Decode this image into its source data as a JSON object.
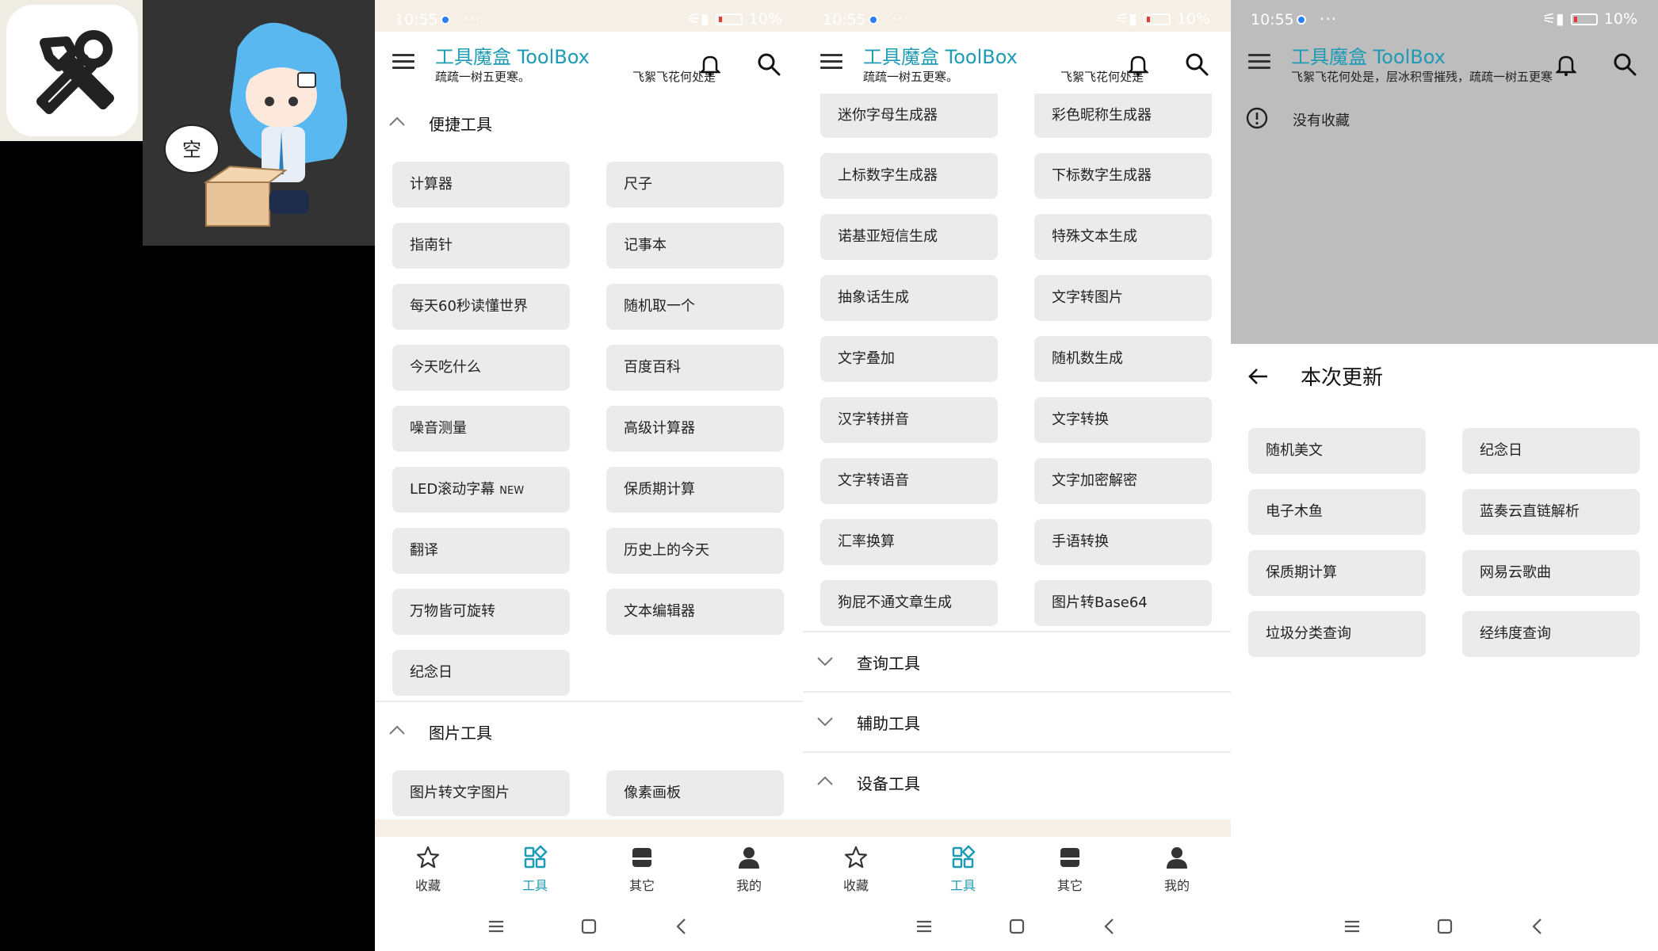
{
  "promo": {
    "logo_icon": "tools-wrench-hammer-icon",
    "mascot_badge": "空"
  },
  "status": {
    "time": "10:55",
    "more": "···",
    "battery": "10%"
  },
  "app": {
    "title": "工具魔盒 ToolBox",
    "subtitle": "疏疏一树五更寒。",
    "marquee": "飞絮飞花何处是",
    "subtitle_full": "飞絮飞花何处是，层冰积雪摧残，疏疏一树五更寒"
  },
  "panel1": {
    "sections": [
      {
        "label": "便捷工具",
        "items": [
          "计算器",
          "尺子",
          "指南针",
          "记事本",
          "每天60秒读懂世界",
          "随机取一个",
          "今天吃什么",
          "百度百科",
          "噪音测量",
          "高级计算器",
          "LED滚动字幕",
          "保质期计算",
          "翻译",
          "历史上的今天",
          "万物皆可旋转",
          "文本编辑器",
          "纪念日"
        ],
        "new_badge": "NEW"
      },
      {
        "label": "图片工具",
        "items": [
          "图片转文字图片",
          "像素画板"
        ]
      }
    ]
  },
  "panel2": {
    "items": [
      "迷你字母生成器",
      "彩色昵称生成器",
      "上标数字生成器",
      "下标数字生成器",
      "诺基亚短信生成",
      "特殊文本生成",
      "抽象话生成",
      "文字转图片",
      "文字叠加",
      "随机数生成",
      "汉字转拼音",
      "文字转换",
      "文字转语音",
      "文字加密解密",
      "汇率换算",
      "手语转换",
      "狗屁不通文章生成",
      "图片转Base64"
    ],
    "sections": [
      "查询工具",
      "辅助工具",
      "设备工具"
    ]
  },
  "panel3": {
    "empty_text": "没有收藏",
    "sheet_title": "本次更新",
    "items": [
      "随机美文",
      "纪念日",
      "电子木鱼",
      "蓝奏云直链解析",
      "保质期计算",
      "网易云歌曲",
      "垃圾分类查询",
      "经纬度查询"
    ]
  },
  "nav": {
    "items": [
      {
        "label": "收藏",
        "icon": "star-icon"
      },
      {
        "label": "工具",
        "icon": "grid-apps-icon"
      },
      {
        "label": "其它",
        "icon": "box-icon"
      },
      {
        "label": "我的",
        "icon": "person-icon"
      }
    ]
  },
  "colors": {
    "accent": "#1d9bb4",
    "button_bg": "#ebebeb",
    "status_bg": "#f6efe6",
    "dim": "#bdbdbd"
  }
}
